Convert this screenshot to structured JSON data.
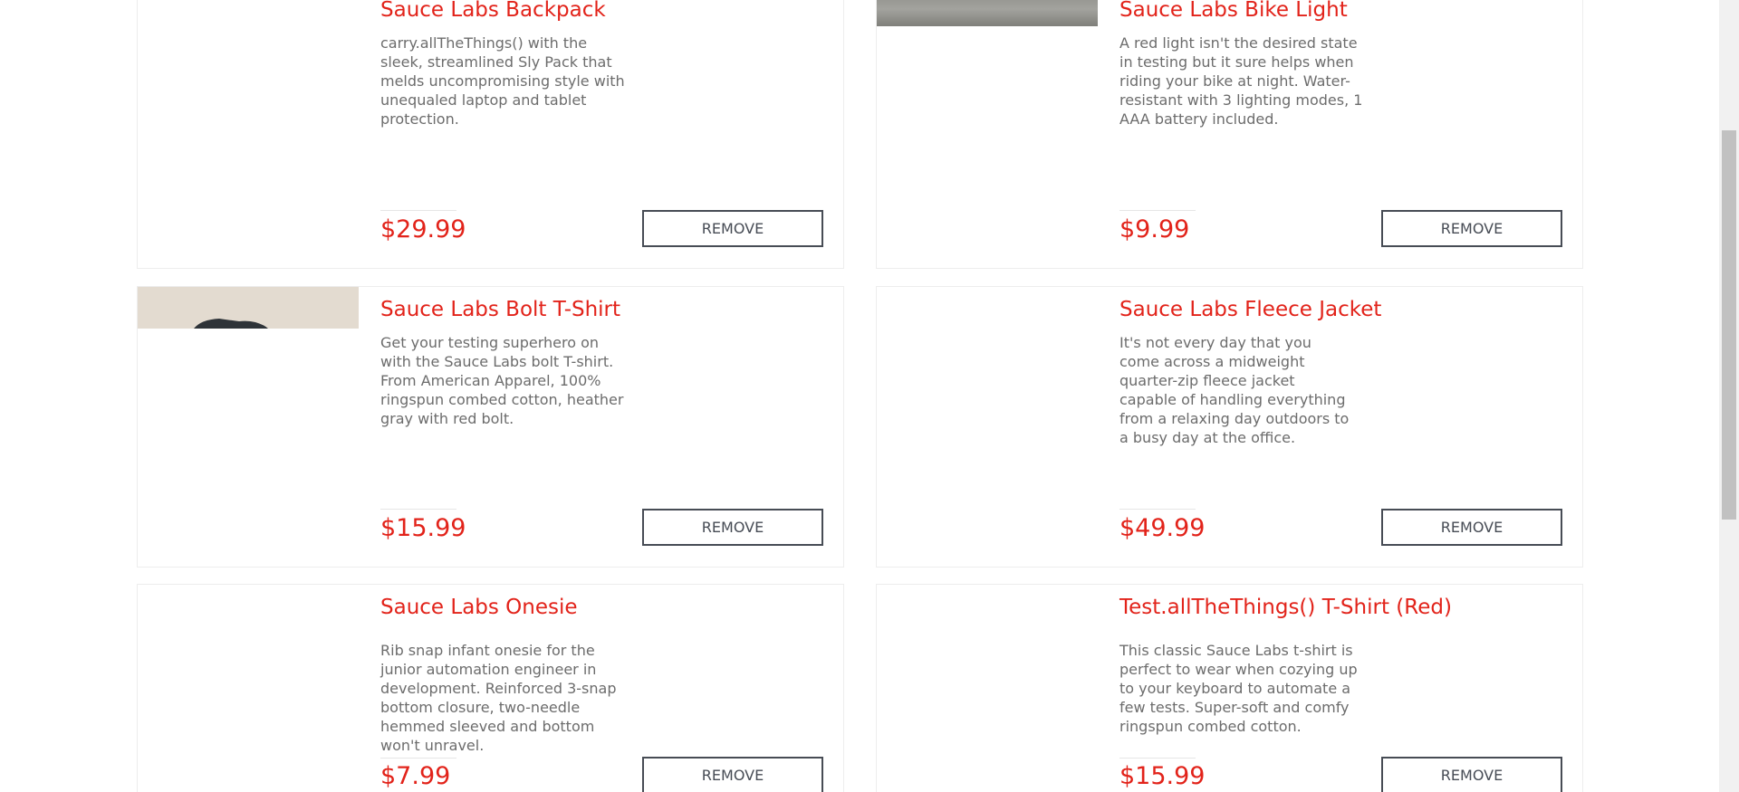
{
  "inventory": {
    "items": [
      {
        "name": "Sauce Labs Backpack",
        "description": "carry.allTheThings() with the sleek, streamlined Sly Pack that melds uncompromising style with unequaled laptop and tablet protection.",
        "price": "$29.99",
        "button_label": "REMOVE"
      },
      {
        "name": "Sauce Labs Bike Light",
        "description": "A red light isn't the desired state in testing but it sure helps when riding your bike at night. Water-resistant with 3 lighting modes, 1 AAA battery included.",
        "price": "$9.99",
        "button_label": "REMOVE"
      },
      {
        "name": "Sauce Labs Bolt T-Shirt",
        "description": "Get your testing superhero on with the Sauce Labs bolt T-shirt. From American Apparel, 100% ringspun combed cotton, heather gray with red bolt.",
        "price": "$15.99",
        "button_label": "REMOVE"
      },
      {
        "name": "Sauce Labs Fleece Jacket",
        "description": "It's not every day that you come across a midweight quarter-zip fleece jacket capable of handling everything from a relaxing day outdoors to a busy day at the office.",
        "price": "$49.99",
        "button_label": "REMOVE"
      },
      {
        "name": "Sauce Labs Onesie",
        "description": "Rib snap infant onesie for the junior automation engineer in development. Reinforced 3-snap bottom closure, two-needle hemmed sleeved and bottom won't unravel.",
        "price": "$7.99",
        "button_label": "REMOVE"
      },
      {
        "name": "Test.allTheThings() T-Shirt (Red)",
        "description": "This classic Sauce Labs t-shirt is perfect to wear when cozying up to your keyboard to automate a few tests. Super-soft and comfy ringspun combed cotton.",
        "price": "$15.99",
        "button_label": "REMOVE"
      }
    ]
  },
  "colors": {
    "accent": "#e2231a",
    "text_muted": "#6c6c6c",
    "button_border": "#474c55",
    "card_border": "#ededed"
  }
}
